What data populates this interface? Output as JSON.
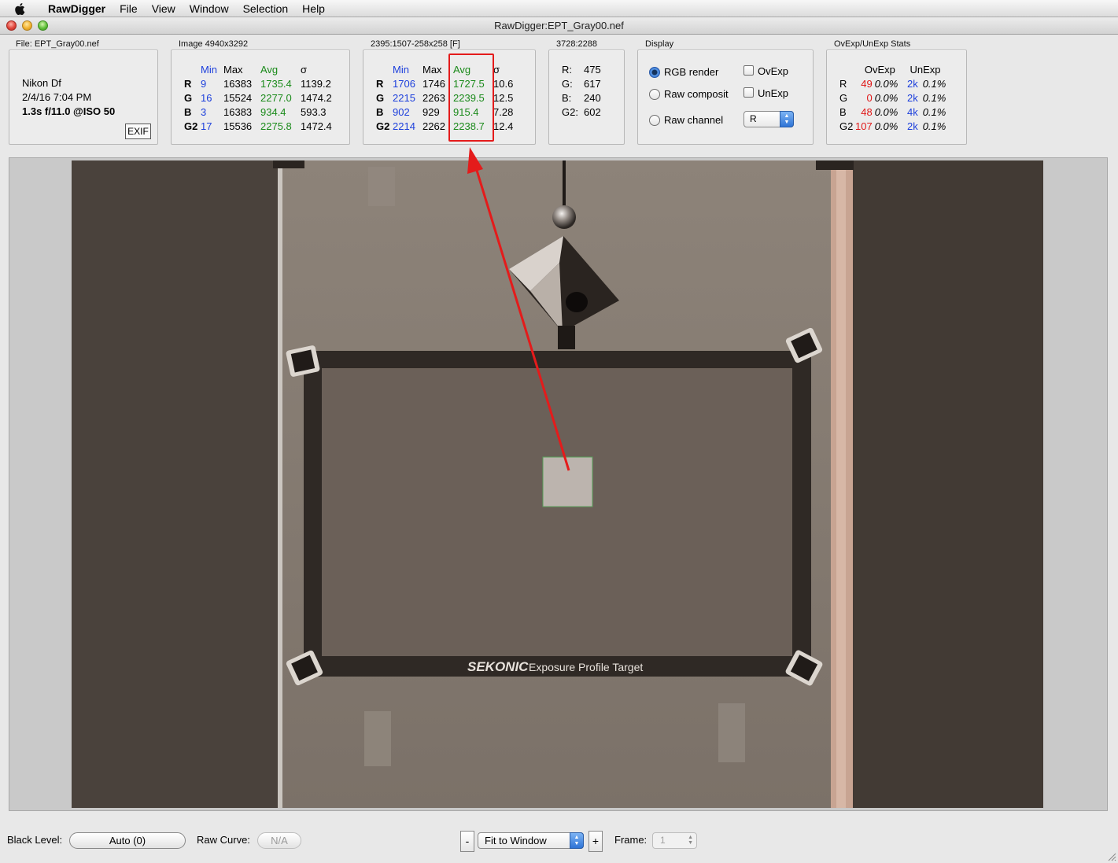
{
  "menubar": {
    "app_name": "RawDigger",
    "items": [
      "File",
      "View",
      "Window",
      "Selection",
      "Help"
    ]
  },
  "window": {
    "title": "RawDigger:EPT_Gray00.nef"
  },
  "file_panel": {
    "label": "File: EPT_Gray00.nef",
    "camera": "Nikon Df",
    "datetime": "2/4/16 7:04 PM",
    "exposure": "1.3s f/11.0 @ISO 50",
    "exif_button": "EXIF"
  },
  "image_panel": {
    "label": "Image 4940x3292",
    "headers": [
      "",
      "Min",
      "Max",
      "Avg",
      "σ"
    ],
    "rows": [
      [
        "R",
        "9",
        "16383",
        "1735.4",
        "1139.2"
      ],
      [
        "G",
        "16",
        "15524",
        "2277.0",
        "1474.2"
      ],
      [
        "B",
        "3",
        "16383",
        "934.4",
        "593.3"
      ],
      [
        "G2",
        "17",
        "15536",
        "2275.8",
        "1472.4"
      ]
    ]
  },
  "selection_panel": {
    "label": "2395:1507-258x258 [F]",
    "headers": [
      "",
      "Min",
      "Max",
      "Avg",
      "σ"
    ],
    "rows": [
      [
        "R",
        "1706",
        "1746",
        "1727.5",
        "10.6"
      ],
      [
        "G",
        "2215",
        "2263",
        "2239.5",
        "12.5"
      ],
      [
        "B",
        "902",
        "929",
        "915.4",
        "7.28"
      ],
      [
        "G2",
        "2214",
        "2262",
        "2238.7",
        "12.4"
      ]
    ]
  },
  "point_panel": {
    "label": "3728:2288",
    "rows": [
      [
        "R:",
        "475"
      ],
      [
        "G:",
        "617"
      ],
      [
        "B:",
        "240"
      ],
      [
        "G2:",
        "602"
      ]
    ]
  },
  "display_panel": {
    "label": "Display",
    "rgb_render": "RGB render",
    "raw_composit": "Raw composit",
    "raw_channel": "Raw channel",
    "ovexp": "OvExp",
    "unexp": "UnExp",
    "channel_value": "R"
  },
  "ovexp_panel": {
    "label": "OvExp/UnExp Stats",
    "headers": [
      "",
      "OvExp",
      "UnExp"
    ],
    "rows": [
      [
        "R",
        "49",
        "0.0%",
        "2k",
        "0.1%"
      ],
      [
        "G",
        "0",
        "0.0%",
        "2k",
        "0.1%"
      ],
      [
        "B",
        "48",
        "0.0%",
        "4k",
        "0.1%"
      ],
      [
        "G2",
        "107",
        "0.0%",
        "2k",
        "0.1%"
      ]
    ]
  },
  "photo": {
    "target_brand": "SEKONIC",
    "target_text": "Exposure Profile Target"
  },
  "bottom": {
    "black_level_label": "Black Level:",
    "black_level_value": "Auto (0)",
    "raw_curve_label": "Raw Curve:",
    "raw_curve_value": "N/A",
    "zoom_minus": "-",
    "zoom_plus": "+",
    "zoom_value": "Fit to Window",
    "frame_label": "Frame:",
    "frame_value": "1"
  },
  "colors": {
    "min_blue": "#1c3fdc",
    "avg_green": "#1a8a1a",
    "ovexp_red": "#e01818",
    "annotation_red": "#e41b1b"
  }
}
